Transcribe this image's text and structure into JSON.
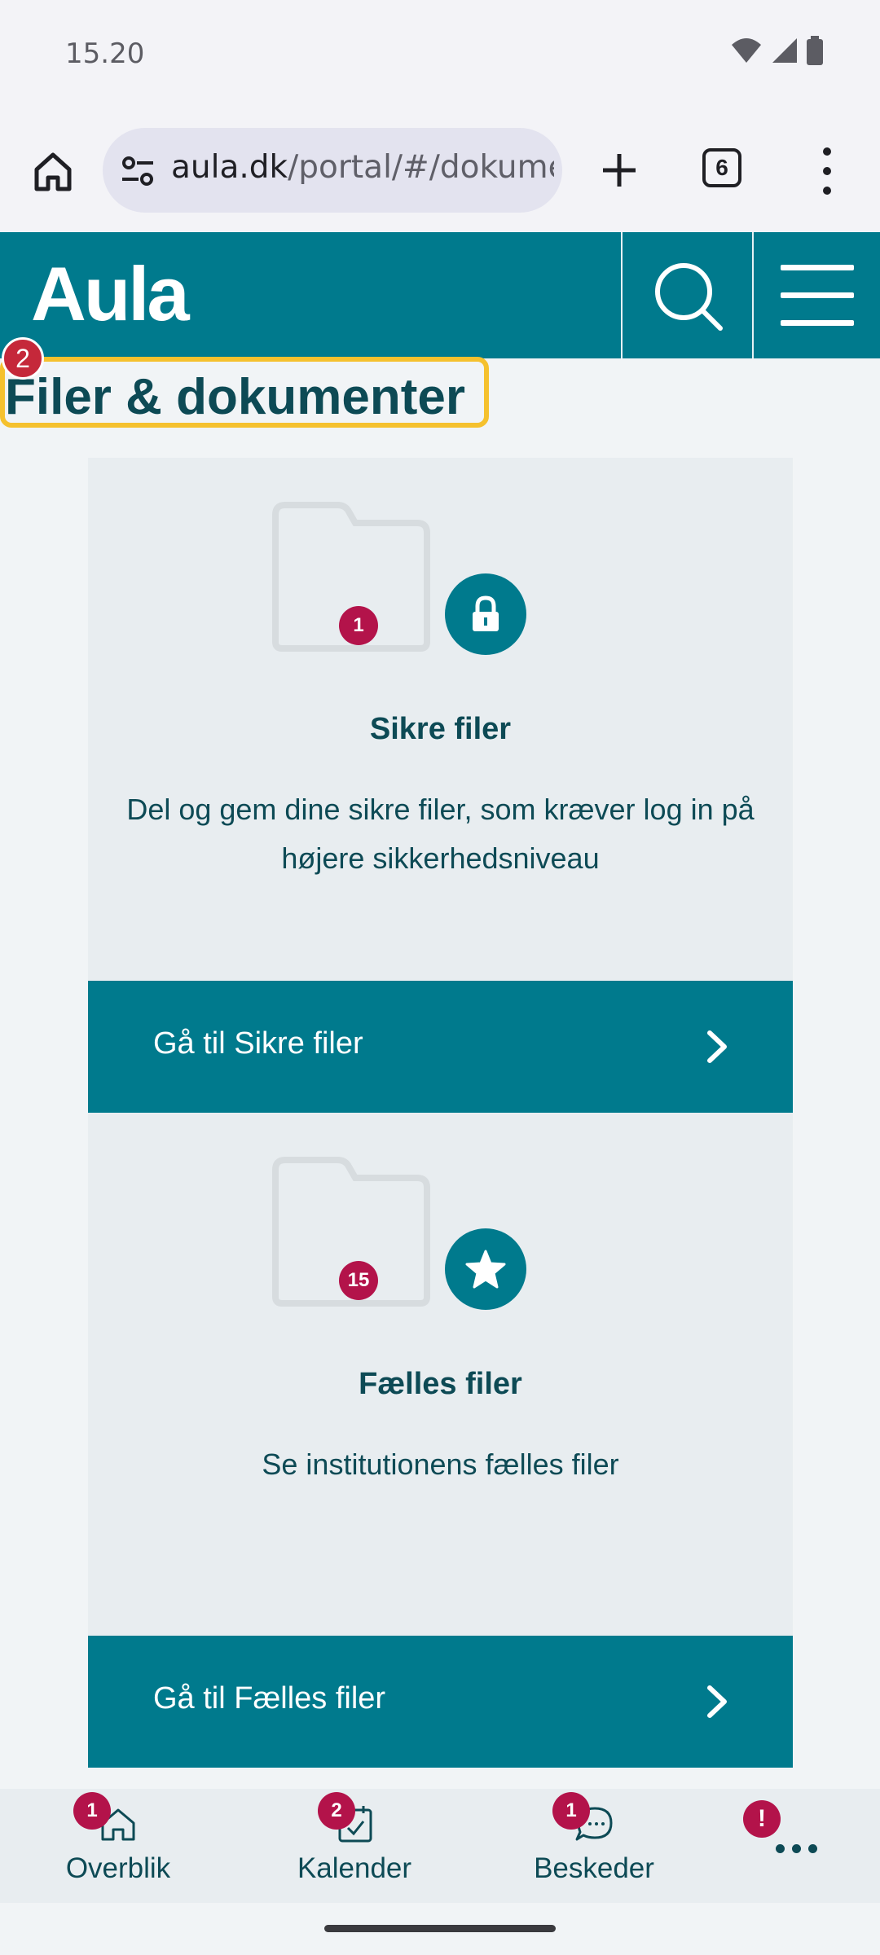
{
  "status_bar": {
    "time": "15.20"
  },
  "browser": {
    "url_host": "aula.dk",
    "url_path": "/portal/#/dokume",
    "tab_count": "6"
  },
  "header": {
    "logo": "Aula"
  },
  "page": {
    "title": "Filer & dokumenter",
    "title_badge": "2"
  },
  "cards": [
    {
      "badge": "1",
      "icon": "lock-icon",
      "title": "Sikre filer",
      "description": "Del og gem dine sikre filer, som kræver log in på højere sikkerhedsniveau",
      "button_label": "Gå til Sikre filer"
    },
    {
      "badge": "15",
      "icon": "star-icon",
      "title": "Fælles filer",
      "description": "Se institutionens fælles filer",
      "button_label": "Gå til Fælles filer"
    }
  ],
  "bottom_nav": {
    "items": [
      {
        "label": "Overblik",
        "badge": "1",
        "icon": "home-icon"
      },
      {
        "label": "Kalender",
        "badge": "2",
        "icon": "calendar-icon"
      },
      {
        "label": "Beskeder",
        "badge": "1",
        "icon": "chat-icon"
      },
      {
        "label": "",
        "badge": "!",
        "icon": "more-icon"
      }
    ]
  },
  "colors": {
    "brand": "#007a8d",
    "badge": "#b3134a",
    "highlight": "#f5c12e",
    "text": "#0d4a55"
  }
}
